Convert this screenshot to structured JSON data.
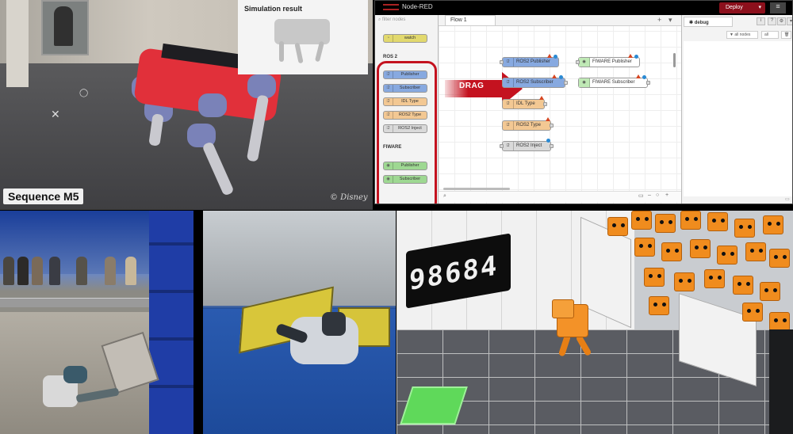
{
  "robot_panel": {
    "simulation_title": "Simulation result",
    "sequence_label": "Sequence M5",
    "watermark": "© Disney"
  },
  "nodered": {
    "title": "Node-RED",
    "deploy_label": "Deploy",
    "menu_icon": "hamburger-icon",
    "palette": {
      "filter_placeholder": "filter nodes",
      "top_node": "watch",
      "categories": [
        {
          "name": "ROS 2",
          "nodes": [
            {
              "label": "Publisher",
              "color": "#87a9e0"
            },
            {
              "label": "Subscriber",
              "color": "#87a9e0"
            },
            {
              "label": "IDL Type",
              "color": "#f3c893"
            },
            {
              "label": "ROS2 Type",
              "color": "#f3c893"
            },
            {
              "label": "ROS2 Inject",
              "color": "#d9d9d9"
            }
          ]
        },
        {
          "name": "FIWARE",
          "nodes": [
            {
              "label": "Publisher",
              "color": "#9ed892"
            },
            {
              "label": "Subscriber",
              "color": "#9ed892"
            }
          ]
        }
      ]
    },
    "workspace": {
      "tab_label": "Flow 1",
      "drag_label": "DRAG",
      "nodes": [
        {
          "label": "ROS2 Publisher",
          "color": "#87a9e0"
        },
        {
          "label": "ROS2 Subscriber",
          "color": "#87a9e0"
        },
        {
          "label": "IDL Type",
          "color": "#f3c893"
        },
        {
          "label": "ROS2 Type",
          "color": "#f3c893"
        },
        {
          "label": "ROS2 Inject",
          "color": "#d9d9d9"
        },
        {
          "label": "FIWARE Publisher",
          "color": "#ffffff"
        },
        {
          "label": "FIWARE Subscriber",
          "color": "#ffffff"
        }
      ]
    },
    "sidebar": {
      "tab_label": "debug",
      "filter_label": "all nodes",
      "clear_label": "all"
    },
    "accent": "#c4121f"
  },
  "sim_panel": {
    "score": "98684"
  }
}
